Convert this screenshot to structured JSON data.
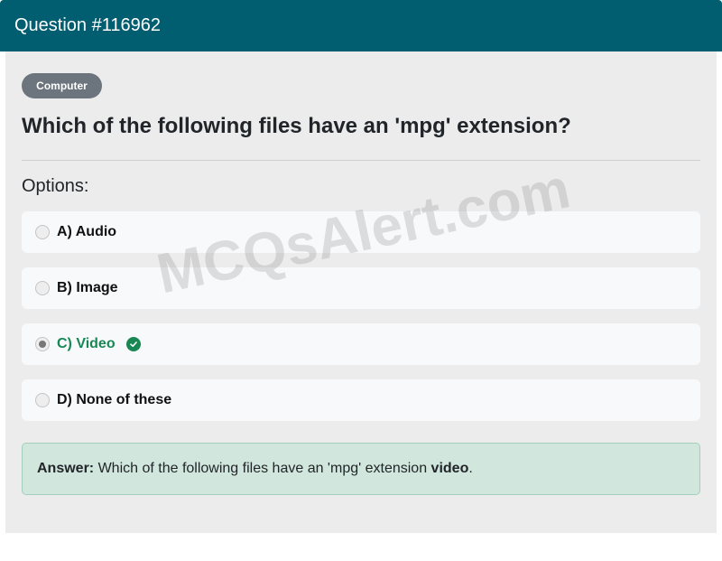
{
  "header": {
    "title": "Question #116962"
  },
  "category": {
    "label": "Computer"
  },
  "question": {
    "text": "Which of the following files have an 'mpg' extension?"
  },
  "options_heading": "Options:",
  "options": [
    {
      "label": "A) Audio",
      "selected": false,
      "correct": false
    },
    {
      "label": "B) Image",
      "selected": false,
      "correct": false
    },
    {
      "label": "C) Video",
      "selected": true,
      "correct": true
    },
    {
      "label": "D) None of these",
      "selected": false,
      "correct": false
    }
  ],
  "answer": {
    "prefix": "Answer:",
    "text": " Which of the following files have an 'mpg' extension ",
    "value": "video",
    "suffix": "."
  },
  "watermark": "MCQsAlert.com",
  "colors": {
    "header": "#015d70",
    "badge": "#6c757d",
    "correct": "#198754",
    "answer_bg": "#d1e7dd"
  },
  "icons": {
    "correct": "check-circle-icon"
  }
}
